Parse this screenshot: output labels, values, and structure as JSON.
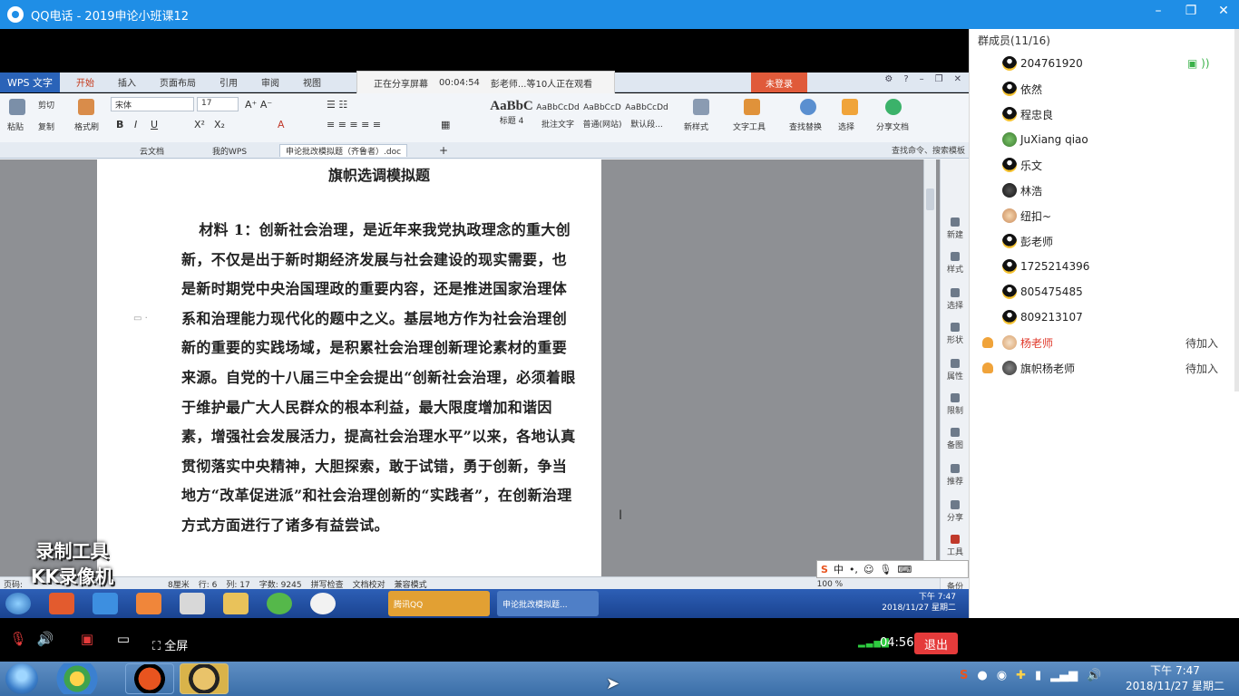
{
  "qq_window": {
    "title": "QQ电话 - 2019申论小班课12",
    "controls": [
      "minimize",
      "maximize",
      "close"
    ]
  },
  "shared_screen": {
    "wps": {
      "app_label": "WPS 文字",
      "menu": [
        "开始",
        "插入",
        "页面布局",
        "引用",
        "审阅",
        "视图"
      ],
      "login_label": "未登录"
    },
    "share_banner": {
      "status": "正在分享屏幕",
      "duration": "00:04:54",
      "viewers": "彭老师...等10人正在观看"
    },
    "ribbon": {
      "paste": "粘贴",
      "cut": "剪切",
      "copy": "复制",
      "format_painter": "格式刷",
      "font_name": "宋体",
      "font_size": "17",
      "styles": [
        {
          "sample": "AaBbC",
          "name": "标题 4"
        },
        {
          "sample": "AaBbCcDd",
          "name": "批注文字"
        },
        {
          "sample": "AaBbCcD",
          "name": "普通(网站)"
        },
        {
          "sample": "AaBbCcDd",
          "name": "默认段..."
        }
      ],
      "new_style": "新样式",
      "text_tools": "文字工具",
      "find_replace": "查找替换",
      "select": "选择",
      "share_doc": "分享文档"
    },
    "tabs": {
      "cloud": "云文档",
      "my_wps": "我的WPS",
      "current_doc": "申论批改模拟题（齐鲁者）.doc",
      "search_hint": "查找命令、搜索模板"
    },
    "document": {
      "title": "旗帜选调模拟题",
      "paragraph": "材料 1：创新社会治理，是近年来我党执政理念的重大创新，不仅是出于新时期经济发展与社会建设的现实需要，也是新时期党中央治国理政的重要内容，还是推进国家治理体系和治理能力现代化的题中之义。基层地方作为社会治理创新的重要的实践场域，是积累社会治理创新理论素材的重要来源。自党的十八届三中全会提出“创新社会治理，必须着眼于维护最广大人民群众的根本利益，最大限度增加和谐因素，增强社会发展活力，提高社会治理水平”以来，各地认真贯彻落实中央精神，大胆探索，敢于试错，勇于创新，争当地方“改革促进派”和社会治理创新的“实践者”，在创新治理方式方面进行了诸多有益尝试。"
    },
    "right_tools": [
      "新建",
      "样式",
      "选择",
      "形状",
      "属性",
      "限制",
      "备图",
      "推荐",
      "分享",
      "工具",
      "备份"
    ],
    "statusbar": {
      "page": "页码:",
      "position": "8厘米",
      "row": "行: 6",
      "col": "列: 17",
      "words": "字数: 9245",
      "spell": "拼写检查",
      "proof": "文档校对",
      "compat": "兼容模式",
      "zoom": "100 %"
    },
    "ime": {
      "lang": "中"
    },
    "watermark": [
      "录制工具",
      "KK录像机"
    ],
    "inner_taskbar": {
      "app_qq": "腾讯QQ",
      "app_wps": "申论批改模拟题...",
      "time": "下午 7:47",
      "date": "2018/11/27 星期二"
    }
  },
  "member_panel": {
    "heading": "群成员(11/16)",
    "members": [
      {
        "name": "204761920",
        "status": ""
      },
      {
        "name": "依然",
        "status": ""
      },
      {
        "name": "程忠良",
        "status": ""
      },
      {
        "name": "JuXiang qiao",
        "status": ""
      },
      {
        "name": "乐文",
        "status": ""
      },
      {
        "name": "林浩",
        "status": ""
      },
      {
        "name": "纽扣~",
        "status": ""
      },
      {
        "name": "彭老师",
        "status": ""
      },
      {
        "name": "1725214396",
        "status": ""
      },
      {
        "name": "805475485",
        "status": ""
      },
      {
        "name": "809213107",
        "status": ""
      },
      {
        "name": "杨老师",
        "status": "待加入"
      },
      {
        "name": "旗帜杨老师",
        "status": "待加入"
      }
    ]
  },
  "call_bar": {
    "fullscreen": "全屏",
    "timer": "04:56",
    "exit": "退出"
  },
  "taskbar": {
    "time": "下午 7:47",
    "date": "2018/11/27 星期二"
  },
  "colors": {
    "qq_blue": "#1f8ee6",
    "exit_red": "#e53b3b",
    "waiting_name_red": "#e0392b"
  }
}
